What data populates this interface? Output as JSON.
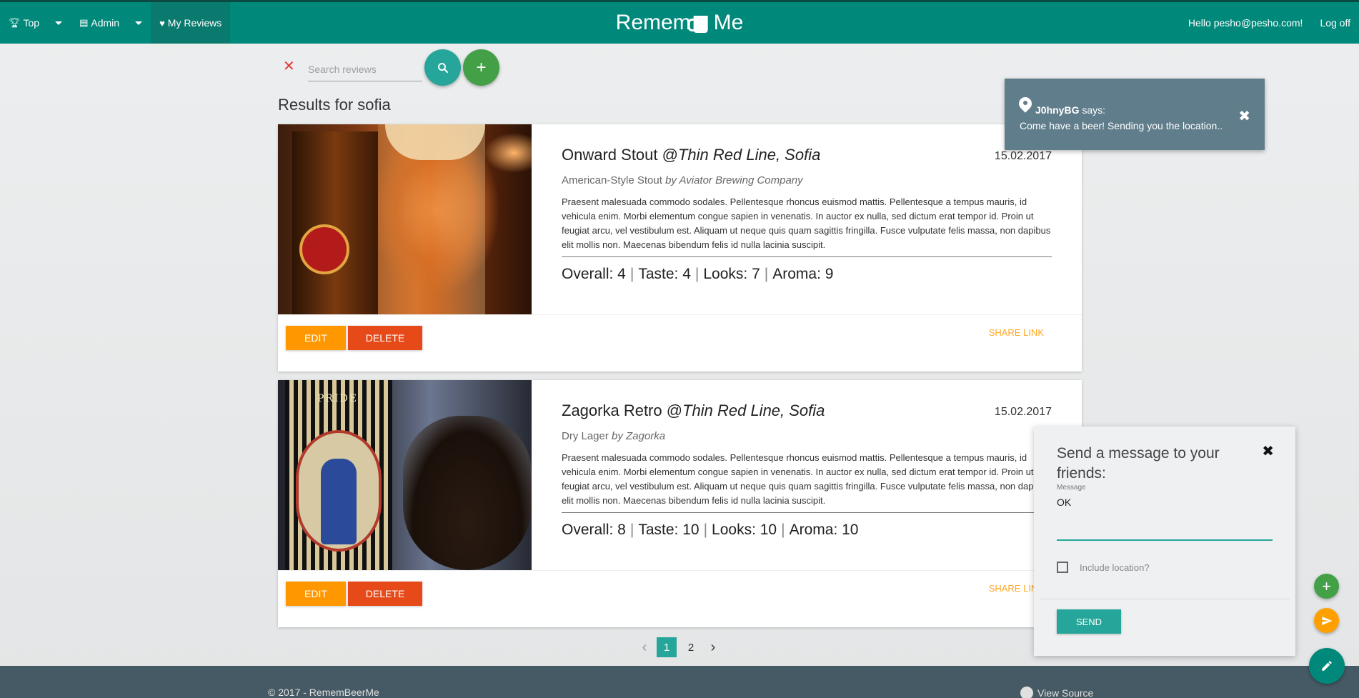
{
  "nav": {
    "top_label": "Top",
    "admin_label": "Admin",
    "my_reviews_label": "My Reviews",
    "brand_left": "Remem",
    "brand_right": "Me",
    "greeting": "Hello pesho@pesho.com!",
    "logoff_label": "Log off"
  },
  "search": {
    "placeholder": "Search reviews",
    "value": "",
    "results_title": "Results for sofia"
  },
  "reviews": [
    {
      "beer": "Onward Stout @",
      "venue": "Thin Red Line, Sofia",
      "date": "15.02.2017",
      "style": "American-Style Stout",
      "brewery": "by Aviator Brewing Company",
      "text": "Praesent malesuada commodo sodales. Pellentesque rhoncus euismod mattis. Pellentesque a tempus mauris, id vehicula enim. Morbi elementum congue sapien in venenatis. In auctor ex nulla, sed dictum erat tempor id. Proin ut feugiat arcu, vel vestibulum est. Aliquam ut neque quis quam sagittis fringilla. Fusce vulputate felis massa, non dapibus elit mollis non. Maecenas bibendum felis id nulla lacinia suscipit.",
      "overall": "Overall: 4",
      "taste": "Taste: 4",
      "looks": "Looks: 7",
      "aroma": "Aroma: 9",
      "edit_label": "Edit",
      "delete_label": "Delete",
      "share_label": "Share link"
    },
    {
      "beer": "Zagorka Retro @",
      "venue": "Thin Red Line, Sofia",
      "date": "15.02.2017",
      "style": "Dry Lager",
      "brewery": "by Zagorka",
      "text": "Praesent malesuada commodo sodales. Pellentesque rhoncus euismod mattis. Pellentesque a tempus mauris, id vehicula enim. Morbi elementum congue sapien in venenatis. In auctor ex nulla, sed dictum erat tempor id. Proin ut feugiat arcu, vel vestibulum est. Aliquam ut neque quis quam sagittis fringilla. Fusce vulputate felis massa, non dapibus elit mollis non. Maecenas bibendum felis id nulla lacinia suscipit.",
      "overall": "Overall: 8",
      "taste": "Taste: 10",
      "looks": "Looks: 10",
      "aroma": "Aroma: 10",
      "edit_label": "Edit",
      "delete_label": "Delete",
      "share_label": "Share link",
      "image_text": "PRIDE"
    }
  ],
  "pagination": {
    "pages": [
      "1",
      "2"
    ],
    "current": "1"
  },
  "footer": {
    "copyright": "© 2017 - RememBeerMe",
    "source_label": "View Source"
  },
  "toast": {
    "user": "J0hnyBG",
    "says": " says:",
    "message": "Come have a beer! Sending you the location.."
  },
  "message_panel": {
    "title": "Send a message to your friends:",
    "field_label": "Message",
    "field_value": "OK",
    "include_location_label": "Include location?",
    "include_location_checked": false,
    "send_label": "Send"
  },
  "colors": {
    "primary": "#00897b",
    "accent_teal": "#26a69a",
    "edit": "#ff9800",
    "delete": "#e64a19",
    "add_green": "#43a047",
    "toast_bg": "#607d8b",
    "footer_bg": "#455a64"
  },
  "icons": {
    "top": "trophy-icon",
    "admin": "id-card-icon",
    "my_reviews": "heart-icon",
    "search": "search-icon",
    "add": "plus-icon",
    "clear": "close-icon",
    "location": "map-pin-icon",
    "send": "paper-plane-icon",
    "edit": "pencil-icon",
    "github": "github-icon"
  }
}
